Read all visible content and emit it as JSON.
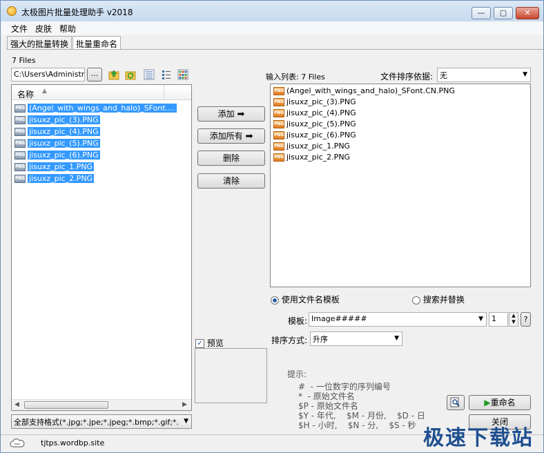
{
  "window": {
    "title": "太极图片批量处理助手  v2018",
    "minimize": "—",
    "maximize": "▢",
    "close": "✕"
  },
  "menu": [
    "文件",
    "皮肤",
    "帮助"
  ],
  "tabs": [
    "强大的批量转换",
    "批量重命名"
  ],
  "left": {
    "file_count": "7 Files",
    "path": "C:\\Users\\Administrat",
    "browse": "...",
    "column_header": "名称",
    "files": [
      "(Angel_with_wings_and_halo)_SFont....",
      "jisuxz_pic_(3).PNG",
      "jisuxz_pic_(4).PNG",
      "jisuxz_pic_(5).PNG",
      "jisuxz_pic_(6).PNG",
      "jisuxz_pic_1.PNG",
      "jisuxz_pic_2.PNG"
    ],
    "filter": "全部支持格式(*.jpg;*.jpe;*.jpeg;*.bmp;*.gif;*."
  },
  "middle": {
    "add": "添加",
    "add_all": "添加所有",
    "delete": "删除",
    "clear": "清除",
    "preview": "预览"
  },
  "right": {
    "input_list_label": "输入列表: 7 Files",
    "sort_label": "文件排序依据:",
    "sort_value": "无",
    "files": [
      "(Angel_with_wings_and_halo)_SFont.CN.PNG",
      "jisuxz_pic_(3).PNG",
      "jisuxz_pic_(4).PNG",
      "jisuxz_pic_(5).PNG",
      "jisuxz_pic_(6).PNG",
      "jisuxz_pic_1.PNG",
      "jisuxz_pic_2.PNG"
    ],
    "use_template": "使用文件名模板",
    "search_replace": "搜索并替换",
    "template_label": "模板:",
    "template_value": "Image#####",
    "start_value": "1",
    "help": "?",
    "order_label": "排序方式:",
    "order_value": "升序",
    "hint_title": "提示:",
    "hint_lines": [
      "#  - 一位数字的序列编号",
      "*  - 原始文件名",
      "$P - 原始文件名",
      "$Y - 年代,    $M - 月份,    $D - 日",
      "$H - 小时,    $N - 分,    $S - 秒"
    ],
    "rename": "重命名",
    "close": "关闭"
  },
  "status": {
    "url": "tjtps.wordbp.site"
  },
  "watermark": "极速下载站",
  "icons": [
    "app-icon",
    "folder-up-icon",
    "refresh-icon",
    "list-view-icon",
    "detail-view-icon",
    "thumbnail-view-icon",
    "arrow-right-icon",
    "magnifier-icon",
    "play-icon",
    "cloud-icon"
  ]
}
